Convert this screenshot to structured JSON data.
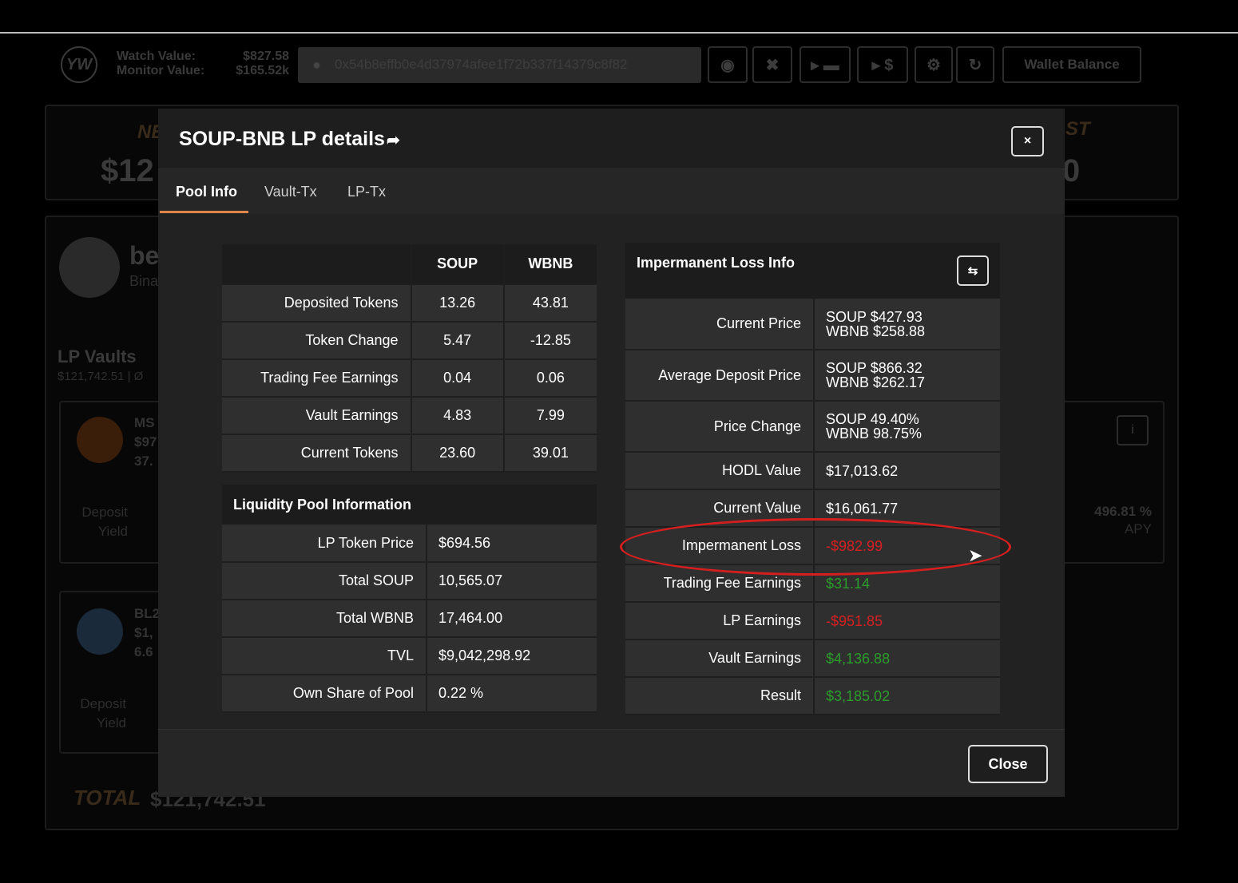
{
  "background": {
    "watch_label": "Watch Value:",
    "monitor_label": "Monitor Value:",
    "watch_value": "$827.58",
    "monitor_value": "$165.52k",
    "address": "0x54b8effb0e4d37974afee1f72b337f14379c8f82",
    "wallet_balance": "Wallet Balance",
    "net_label": "NE",
    "net_value": "$12",
    "cost_label": "ST",
    "cost_value": "0",
    "be_label": "be",
    "bina_label": "Bina",
    "lp_vaults": "LP Vaults",
    "lp_vaults_sub": "$121,742.51 | Ø",
    "vault1_name": "MS",
    "vault1_value": "$97",
    "vault1_sub": "37.",
    "vault1_deposit": "Deposit",
    "vault1_yield": "Yield",
    "vault1_apy_value": "496.81 %",
    "vault1_apy": "APY",
    "vault2_name": "BL2",
    "vault2_value": "$1,",
    "vault2_sub": "6.6",
    "vault2_deposit": "Deposit",
    "vault2_yield": "Yield",
    "total_label": "TOTAL",
    "total_value": "$121,742.51"
  },
  "modal": {
    "title": "SOUP-BNB LP details",
    "close_x": "×",
    "tabs": [
      "Pool Info",
      "Vault-Tx",
      "LP-Tx"
    ],
    "close_button": "Close"
  },
  "token_table": {
    "headers": [
      "",
      "SOUP",
      "WBNB"
    ],
    "rows": [
      {
        "label": "Deposited Tokens",
        "soup": "13.26",
        "wbnb": "43.81"
      },
      {
        "label": "Token Change",
        "soup": "5.47",
        "wbnb": "-12.85"
      },
      {
        "label": "Trading Fee Earnings",
        "soup": "0.04",
        "wbnb": "0.06"
      },
      {
        "label": "Vault Earnings",
        "soup": "4.83",
        "wbnb": "7.99"
      },
      {
        "label": "Current Tokens",
        "soup": "23.60",
        "wbnb": "39.01"
      }
    ]
  },
  "lp_info": {
    "title": "Liquidity Pool Information",
    "rows": [
      {
        "label": "LP Token Price",
        "value": "$694.56"
      },
      {
        "label": "Total SOUP",
        "value": "10,565.07"
      },
      {
        "label": "Total WBNB",
        "value": "17,464.00"
      },
      {
        "label": "TVL",
        "value": "$9,042,298.92"
      },
      {
        "label": "Own Share of Pool",
        "value": "0.22 %"
      }
    ]
  },
  "il_info": {
    "title": "Impermanent Loss Info",
    "rows": [
      {
        "label": "Current Price",
        "line1": "SOUP $427.93",
        "line2": "WBNB $258.88"
      },
      {
        "label": "Average Deposit Price",
        "line1": "SOUP $866.32",
        "line2": "WBNB $262.17"
      },
      {
        "label": "Price Change",
        "line1": "SOUP 49.40%",
        "line2": "WBNB 98.75%"
      },
      {
        "label": "HODL Value",
        "value": "$17,013.62"
      },
      {
        "label": "Current Value",
        "value": "$16,061.77"
      },
      {
        "label": "Impermanent Loss",
        "value": "-$982.99"
      },
      {
        "label": "Trading Fee Earnings",
        "value": "$31.14"
      },
      {
        "label": "LP Earnings",
        "value": "-$951.85"
      },
      {
        "label": "Vault Earnings",
        "value": "$4,136.88"
      },
      {
        "label": "Result",
        "value": "$3,185.02"
      }
    ]
  },
  "colors": {
    "accent": "#e0864a",
    "negative": "#d42020",
    "positive": "#2b9d2b",
    "highlight_ellipse": "#d51f1f"
  }
}
